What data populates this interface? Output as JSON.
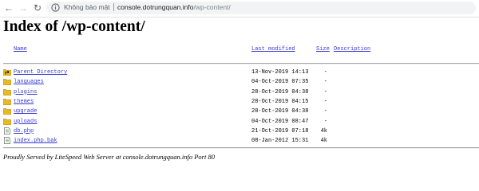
{
  "browser": {
    "security_label": "Không bảo mật",
    "url_host": "console.dotrungquan.info",
    "url_path": "/wp-content/"
  },
  "page": {
    "title": "Index of /wp-content/",
    "columns": {
      "name": "Name",
      "last_modified": "Last modified",
      "size": "Size",
      "description": "Description"
    },
    "entries": [
      {
        "icon": "folder-up-icon",
        "name": "Parent Directory",
        "modified": "13-Nov-2019 14:13",
        "size": "-"
      },
      {
        "icon": "folder-icon",
        "name": "languages",
        "modified": "04-Oct-2019 07:35",
        "size": "-"
      },
      {
        "icon": "folder-icon",
        "name": "plugins",
        "modified": "28-Oct-2019 04:38",
        "size": "-"
      },
      {
        "icon": "folder-icon",
        "name": "themes",
        "modified": "28-Oct-2019 04:15",
        "size": "-"
      },
      {
        "icon": "folder-icon",
        "name": "upgrade",
        "modified": "28-Oct-2019 04:38",
        "size": "-"
      },
      {
        "icon": "folder-icon",
        "name": "uploads",
        "modified": "04-Oct-2019 08:47",
        "size": "-"
      },
      {
        "icon": "file-icon",
        "name": "db.php",
        "modified": "21-Oct-2019 07:18",
        "size": "4k"
      },
      {
        "icon": "file-icon",
        "name": "index.php.bak",
        "modified": "08-Jan-2012 15:31",
        "size": "4k"
      }
    ],
    "footer": "Proudly Served by LiteSpeed Web Server at console.dotrungquan.info Port 80"
  },
  "colors": {
    "link": "#3a3ad0",
    "folder": "#e8b923",
    "toolbar_bg": "#f1f3f4"
  }
}
